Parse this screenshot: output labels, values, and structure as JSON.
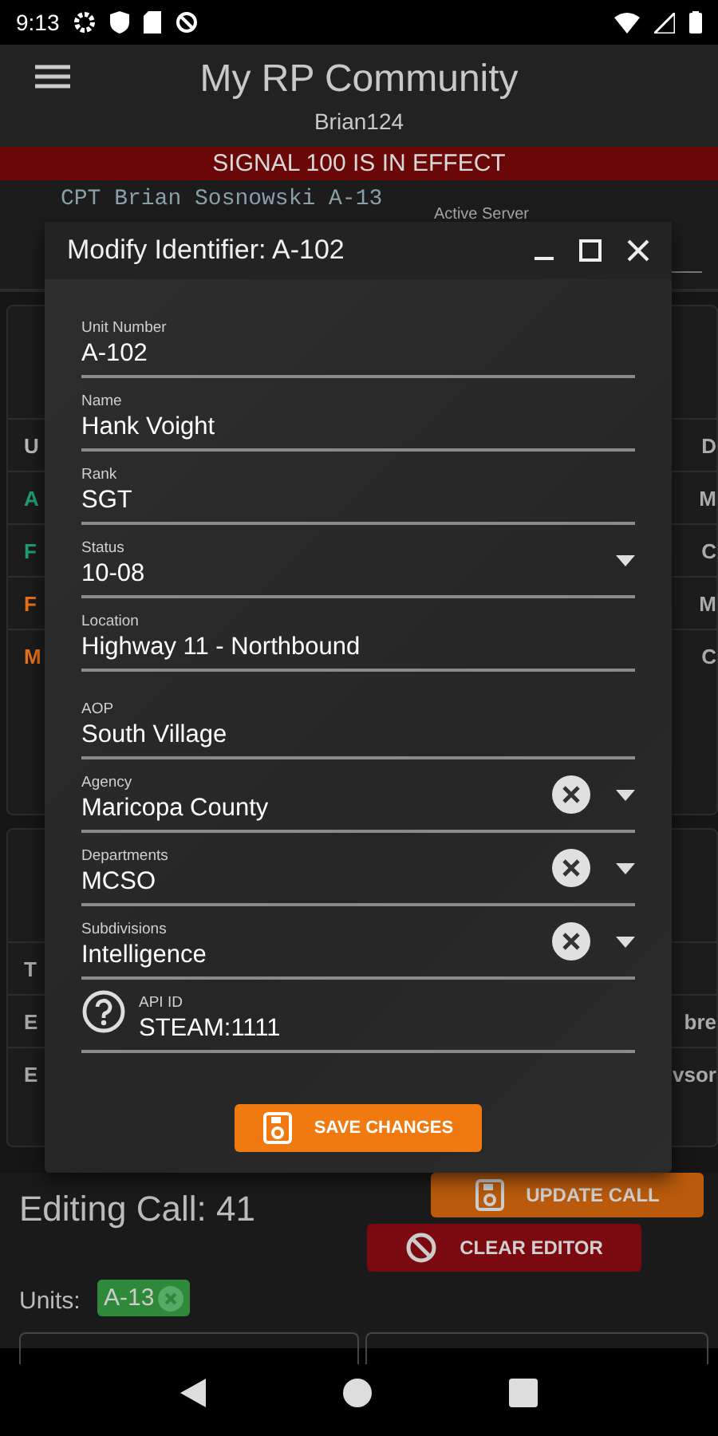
{
  "status_bar": {
    "time": "9:13"
  },
  "app_bar": {
    "title": "My RP Community",
    "subtitle": "Brian124"
  },
  "banner": {
    "text": "SIGNAL 100 IS IN EFFECT"
  },
  "user": {
    "identifier": "CPT Brian Sosnowski A-13",
    "server_label": "Active Server"
  },
  "units_panel": {
    "rows": [
      {
        "left": "U",
        "right": "D",
        "color": "#bbbbbb"
      },
      {
        "left": "A",
        "right": "M",
        "color": "#1e9e78"
      },
      {
        "left": "F",
        "right": "C",
        "color": "#1e9e78"
      },
      {
        "left": "F",
        "right": "M",
        "color": "#e8711a"
      },
      {
        "left": "M",
        "right": "C",
        "color": "#e8711a"
      }
    ]
  },
  "calls_panel": {
    "rows": [
      {
        "left": "T",
        "right": ""
      },
      {
        "left": "E",
        "right": "bre"
      },
      {
        "left": "E",
        "right": "vsor"
      }
    ]
  },
  "dialog": {
    "title": "Modify Identifier: A-102",
    "fields": [
      {
        "kind": "text",
        "label": "Unit Number",
        "value": "A-102"
      },
      {
        "kind": "text",
        "label": "Name",
        "value": "Hank Voight"
      },
      {
        "kind": "text",
        "label": "Rank",
        "value": "SGT"
      },
      {
        "kind": "dropdown",
        "label": "Status",
        "value": "10-08"
      },
      {
        "kind": "text",
        "label": "Location",
        "value": "Highway 11 - Northbound"
      },
      {
        "kind": "text",
        "label": "AOP",
        "value": "South Village"
      },
      {
        "kind": "clearable",
        "label": "Agency",
        "value": "Maricopa County"
      },
      {
        "kind": "clearable",
        "label": "Departments",
        "value": "MCSO"
      },
      {
        "kind": "clearable",
        "label": "Subdivisions",
        "value": "Intelligence"
      },
      {
        "kind": "help",
        "label": "API ID",
        "value": "STEAM:1111"
      }
    ],
    "save_button": "SAVE CHANGES"
  },
  "editor": {
    "title": "Editing Call: 41",
    "update_button": "UPDATE CALL",
    "clear_button": "CLEAR EDITOR",
    "units_label": "Units:",
    "units": [
      {
        "label": "A-13"
      }
    ]
  }
}
